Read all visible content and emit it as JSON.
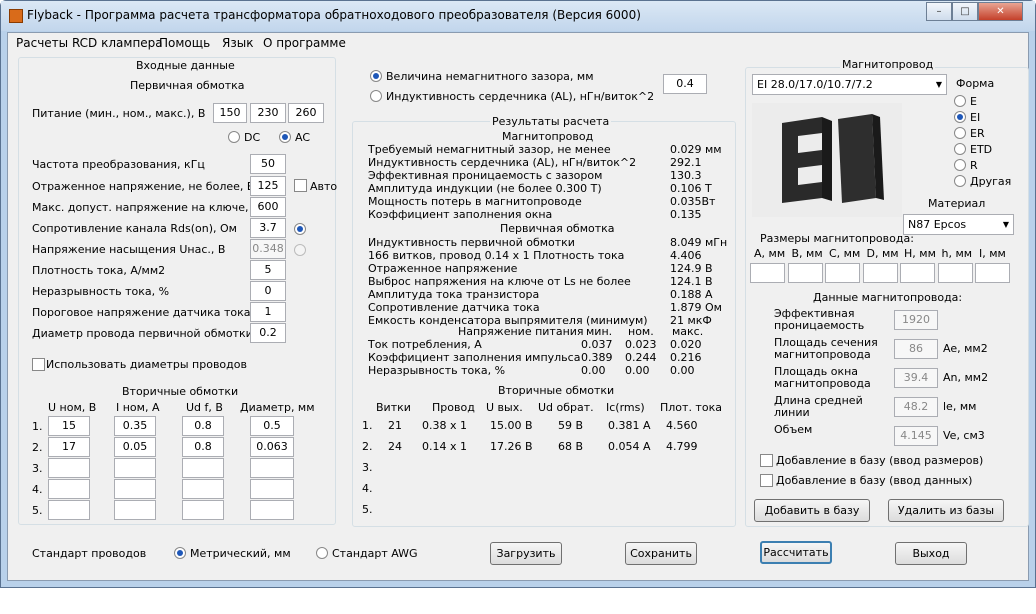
{
  "window": {
    "title": "Flyback - Программа расчета трансформатора обратноходового преобразователя (Версия 6000)",
    "min": "–",
    "max": "□",
    "close": "✕"
  },
  "menu": [
    "Расчеты RCD клампера",
    "Помощь",
    "Язык",
    "О программе"
  ],
  "input": {
    "title": "Входные данные",
    "primary_title": "Первичная обмотка",
    "supply_label": "Питание (мин., ном., макс.), В",
    "supply": [
      "150",
      "230",
      "260"
    ],
    "dc": "DC",
    "ac": "AC",
    "rows": [
      {
        "label": "Частота преобразования, кГц",
        "value": "50"
      },
      {
        "label": "Отраженное напряжение, не более, В",
        "value": "125"
      },
      {
        "label": "Макс. допуст. напряжение на ключе, В",
        "value": "600"
      },
      {
        "label": "Сопротивление канала Rds(on), Ом",
        "value": "3.7"
      },
      {
        "label": "Напряжение насыщения Uнас., В",
        "value": "0.348"
      },
      {
        "label": "Плотность тока, А/мм2",
        "value": "5"
      },
      {
        "label": "Неразрывность тока, %",
        "value": "0"
      },
      {
        "label": "Пороговое напряжение датчика тока, В",
        "value": "1"
      },
      {
        "label": "Диаметр провода первичной обмотки, мм",
        "value": "0.2"
      }
    ],
    "auto": "Авто",
    "use_diam": "Использовать диаметры проводов",
    "sec_title": "Вторичные обмотки",
    "sec_headers": [
      "U ном, В",
      "I ном, А",
      "Ud f, В",
      "Диаметр, мм"
    ],
    "sec_rows": [
      [
        "1.",
        "15",
        "0.35",
        "0.8",
        "0.5"
      ],
      [
        "2.",
        "17",
        "0.05",
        "0.8",
        "0.063"
      ],
      [
        "3.",
        "",
        "",
        "",
        ""
      ],
      [
        "4.",
        "",
        "",
        "",
        ""
      ],
      [
        "5.",
        "",
        "",
        "",
        ""
      ]
    ]
  },
  "gap": {
    "opt1": "Величина немагнитного зазора, мм",
    "opt2": "Индуктивность сердечника (AL), нГн/виток^2",
    "value": "0.4"
  },
  "results": {
    "title": "Результаты расчета",
    "core_title": "Магнитопровод",
    "core_rows": [
      [
        "Требуемый немагнитный зазор, не менее",
        "0.029 мм"
      ],
      [
        "Индуктивность сердечника (AL), нГн/виток^2",
        "292.1"
      ],
      [
        "Эффективная проницаемость с зазором",
        "130.3"
      ],
      [
        "Амплитуда индукции           (не более 0.300 Т)",
        "0.106 Т"
      ],
      [
        "Мощность потерь в магнитопроводе",
        "0.035Вт"
      ],
      [
        "Коэффициент заполнения окна",
        "0.135"
      ]
    ],
    "prim_title": "Первичная обмотка",
    "prim_rows": [
      [
        "Индуктивность первичной обмотки",
        "8.049 мГн"
      ],
      [
        " 166 витков, провод 0.14 x 1            Плотность тока",
        "4.406"
      ],
      [
        "Отраженное напряжение",
        "124.9 В"
      ],
      [
        "Выброс напряжения на ключе от Ls не более",
        "124.1 В"
      ],
      [
        "Амплитуда тока транзистора",
        "0.188 А"
      ],
      [
        "Сопротивление датчика тока",
        "1.879 Ом"
      ],
      [
        "Емкость конденсатора выпрямителя (минимум)",
        "21 мкФ"
      ]
    ],
    "supply_hdr": [
      "Напряжение питания",
      "мин.",
      "ном.",
      "макс."
    ],
    "supply_rows": [
      [
        "Ток потребления, А",
        "0.037",
        "0.023",
        "0.020"
      ],
      [
        "Коэффициент заполнения импульса",
        "0.389",
        "0.244",
        "0.216"
      ],
      [
        "Неразрывность тока, %",
        "0.00",
        "0.00",
        "0.00"
      ]
    ],
    "sec_title": "Вторичные обмотки",
    "sec_headers": [
      "Витки",
      "Провод",
      "U вых.",
      "Ud обрат.",
      "Ic(rms)",
      "Плот. тока"
    ],
    "sec_rows": [
      [
        "1.",
        "21",
        "0.38 x 1",
        "15.00 В",
        "59 В",
        "0.381 А",
        "4.560"
      ],
      [
        "2.",
        "24",
        "0.14 x 1",
        "17.26 В",
        "68 В",
        "0.054 А",
        "4.799"
      ],
      [
        "3.",
        "",
        "",
        "",
        "",
        "",
        ""
      ],
      [
        "4.",
        "",
        "",
        "",
        "",
        "",
        ""
      ],
      [
        "5.",
        "",
        "",
        "",
        "",
        "",
        ""
      ]
    ]
  },
  "core": {
    "title": "Магнитопровод",
    "selected": "EI 28.0/17.0/10.7/7.2",
    "shape_title": "Форма",
    "shapes": [
      "E",
      "EI",
      "ER",
      "ETD",
      "R",
      "Другая"
    ],
    "material_title": "Материал",
    "material": "N87 Epcos",
    "dims_title": "Размеры магнитопровода:",
    "dims": [
      "A, мм",
      "B, мм",
      "C, мм",
      "D, мм",
      "H, мм",
      "h, мм",
      "I, мм"
    ],
    "data_title": "Данные магнитопровода:",
    "data_rows": [
      {
        "label": "Эффективная проницаемость",
        "value": "1920",
        "unit": ""
      },
      {
        "label": "Площадь сечения магнитопровода",
        "value": "86",
        "unit": "Ae, мм2"
      },
      {
        "label": "Площадь окна магнитопровода",
        "value": "39.4",
        "unit": "An, мм2"
      },
      {
        "label": "Длина средней линии",
        "value": "48.2",
        "unit": "le, мм"
      },
      {
        "label": "Объем",
        "value": "4.145",
        "unit": "Ve, см3"
      }
    ],
    "add_dims": "Добавление в базу (ввод размеров)",
    "add_data": "Добавление в базу (ввод данных)",
    "add_btn": "Добавить в базу",
    "del_btn": "Удалить из базы"
  },
  "bottom": {
    "std_label": "Стандарт проводов",
    "metric": "Метрический, мм",
    "awg": "Стандарт AWG",
    "load": "Загрузить",
    "save": "Сохранить",
    "calc": "Рассчитать",
    "exit": "Выход"
  }
}
